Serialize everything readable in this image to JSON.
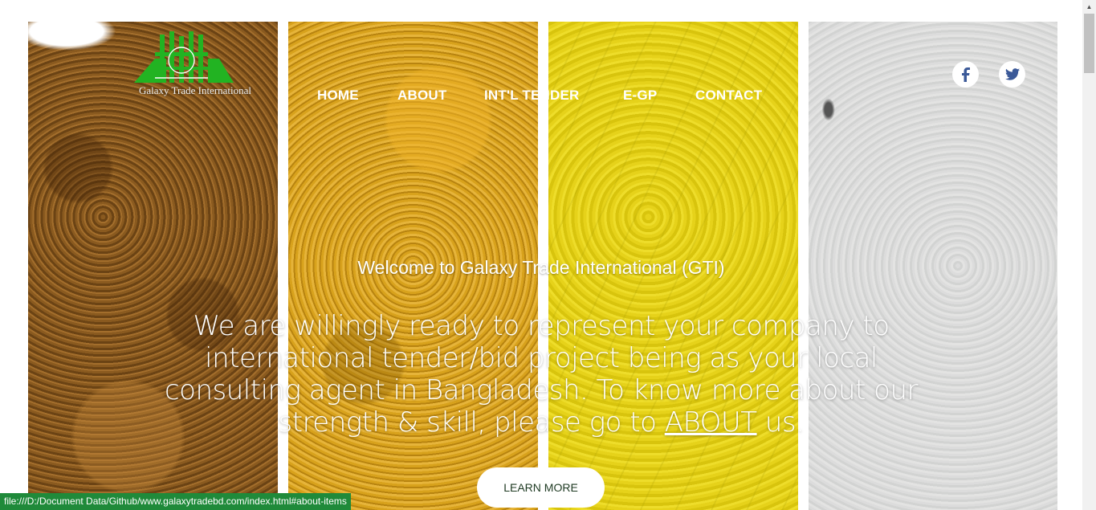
{
  "brand": {
    "name": "Galaxy Trade International",
    "logo_color": "#22b322"
  },
  "nav": {
    "items": [
      {
        "label": "HOME"
      },
      {
        "label": "ABOUT"
      },
      {
        "label": "INT'L TENDER"
      },
      {
        "label": "E-GP"
      },
      {
        "label": "CONTACT"
      }
    ]
  },
  "social": {
    "facebook_icon": "facebook-icon",
    "twitter_icon": "twitter-icon",
    "icon_color": "#3b5998"
  },
  "hero": {
    "welcome": "Welcome to Galaxy Trade International (GTI)",
    "tagline_before": "We are willingly ready to represent your company to international tender/bid project being as your local consulting agent in Bangladesh. To know more about our strength & skill, please go to ",
    "tagline_link": "ABOUT",
    "tagline_after": " us.",
    "cta": "LEARN MORE"
  },
  "status_bar": {
    "url": "file:///D:/Document Data/Github/www.galaxytradebd.com/index.html#about-items",
    "color": "#1f8a3a"
  }
}
